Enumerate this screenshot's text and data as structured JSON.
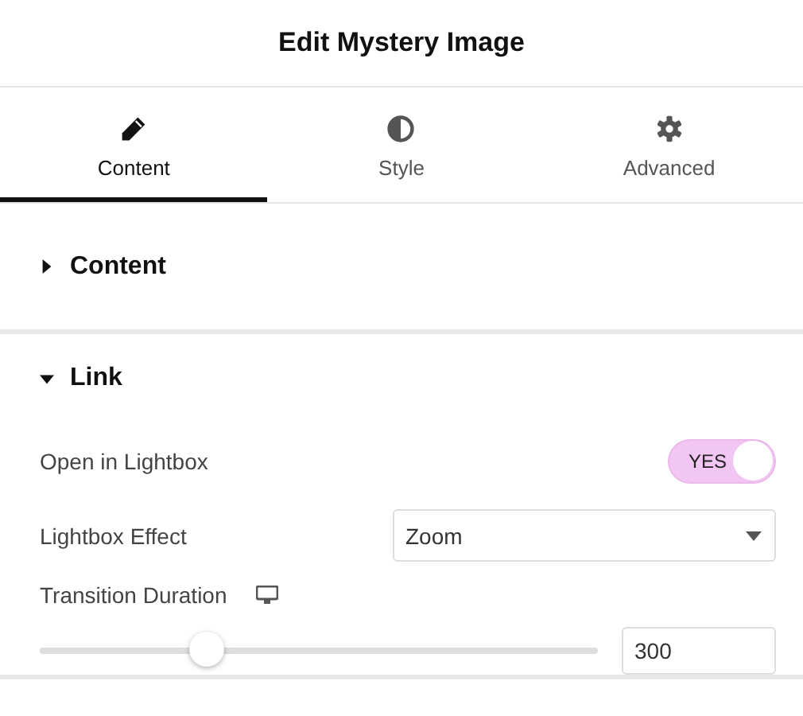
{
  "header": {
    "title": "Edit Mystery Image"
  },
  "tabs": [
    {
      "label": "Content",
      "kind": "edit",
      "selected": true
    },
    {
      "label": "Style",
      "kind": "style",
      "selected": false
    },
    {
      "label": "Advanced",
      "kind": "advanced",
      "selected": false
    }
  ],
  "sections": [
    {
      "title": "Content",
      "expanded": false
    },
    {
      "title": "Link",
      "expanded": true,
      "controls": [
        {
          "kind": "switch",
          "label": "Open in Lightbox",
          "on": true,
          "on_text": "YES"
        },
        {
          "kind": "select",
          "label": "Lightbox Effect",
          "value": "Zoom"
        },
        {
          "kind": "slider",
          "label": "Transition Duration",
          "level": 0.3,
          "value": "300"
        }
      ]
    }
  ]
}
